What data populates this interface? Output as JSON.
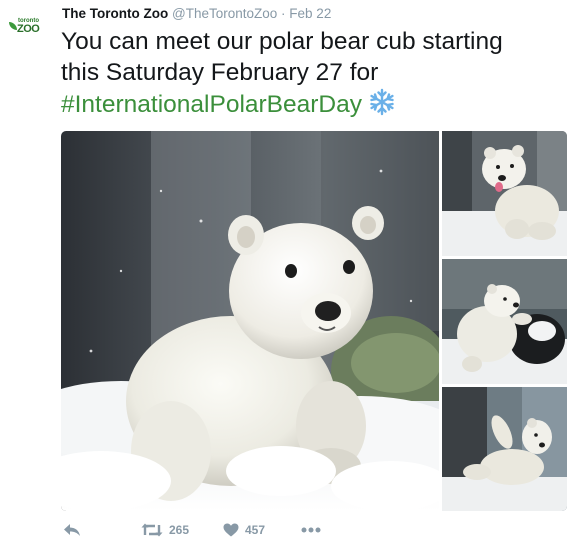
{
  "account": {
    "logo_top": "toronto",
    "logo_main": "ZOO",
    "display_name": "The Toronto Zoo",
    "handle": "@TheTorontoZoo",
    "separator": "·",
    "time": "Feb 22"
  },
  "tweet": {
    "line1": "You can meet our polar bear cub starting",
    "line2": "this Saturday February 27 for",
    "hashtag": "#InternationalPolarBearDay",
    "emoji_icon": "snowflake-icon"
  },
  "media": {
    "photos": [
      {
        "name": "polar-bear-cub-main-photo"
      },
      {
        "name": "polar-bear-cub-snow-photo"
      },
      {
        "name": "polar-bear-cub-ball-photo"
      },
      {
        "name": "polar-bear-cub-wall-photo"
      }
    ]
  },
  "actions": {
    "reply_icon": "reply-icon",
    "retweet_icon": "retweet-icon",
    "retweet_count": "265",
    "like_icon": "heart-icon",
    "like_count": "457",
    "more_icon": "more-dots-icon"
  },
  "colors": {
    "hashtag": "#3b8f3b",
    "meta_gray": "#8899a6",
    "text": "#14171a",
    "snowflake": "#6ab0e8"
  }
}
